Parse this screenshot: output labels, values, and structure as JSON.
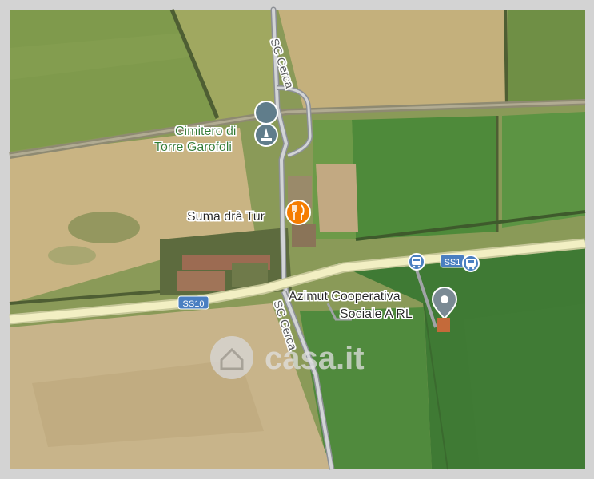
{
  "map": {
    "pois": {
      "cemetery": {
        "line1": "Cimitero di",
        "line2": "Torre Garofoli",
        "icon": "monument-icon"
      },
      "restaurant": {
        "label": "Suma drà Tur",
        "icon": "fork-knife-icon"
      },
      "business": {
        "line1": "Azimut Cooperativa",
        "line2": "Sociale A RL",
        "icon": "location-pin-icon"
      }
    },
    "roads": {
      "cerca_north": "SC Cerca",
      "cerca_south": "SC Cerca",
      "ss10_west": "SS10",
      "ss10_east": "SS1"
    },
    "watermark": {
      "brand": "casa.it"
    },
    "icons": {
      "bus_stop": "bus-icon"
    },
    "colors": {
      "poi_text_green": "#2e7d32",
      "poi_marker_gray": "#607d8b",
      "poi_marker_orange": "#f57c00",
      "road_shield_blue": "#4a7fc1"
    }
  }
}
